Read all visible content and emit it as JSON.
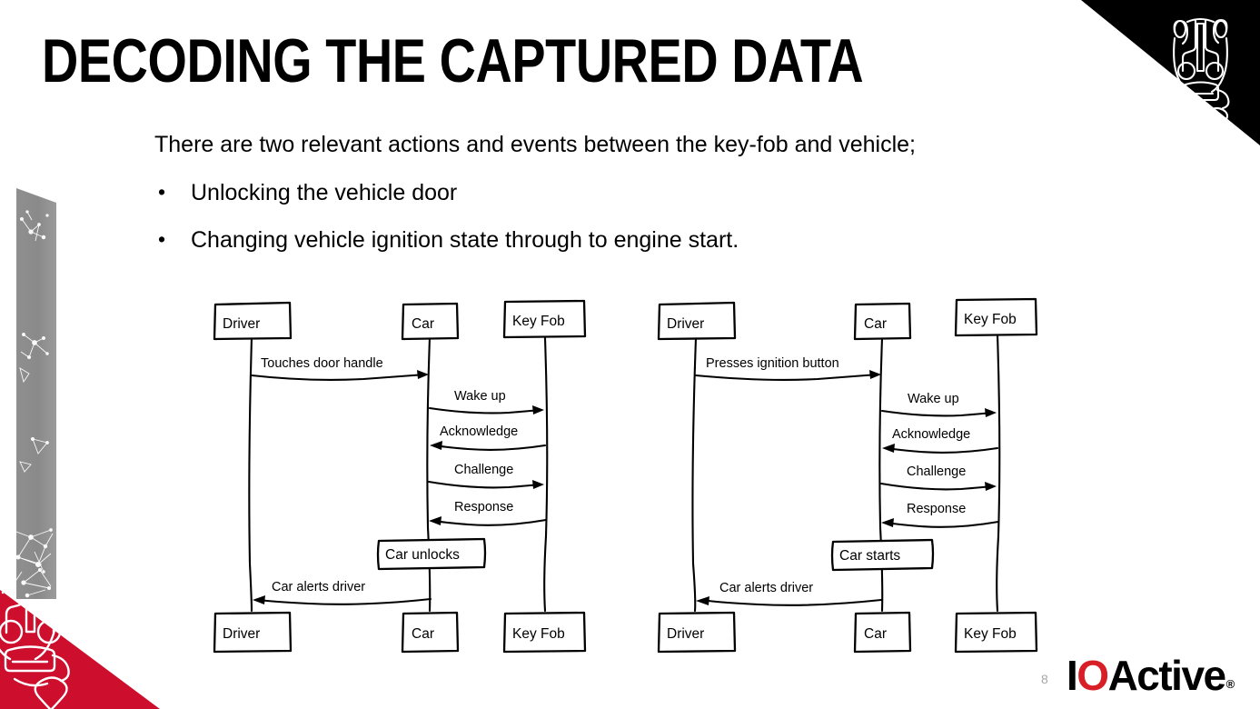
{
  "slide": {
    "title": "DECODING THE CAPTURED DATA",
    "page_number": "8",
    "accent_red": "#ce0e2d",
    "logo_red": "#d81f27",
    "band_gray": "#8c8c8c"
  },
  "body": {
    "lead": "There are two relevant actions and events between the key-fob and vehicle;",
    "bullet_marker": "•",
    "bullets": [
      "Unlocking the vehicle door",
      "Changing vehicle ignition state through to engine start."
    ]
  },
  "brand": {
    "logo_i": "I",
    "logo_o": "O",
    "logo_active": "Active",
    "logo_tm": "®",
    "corner_icon": "badger-head-icon",
    "bottom_icon": "badger-head-icon",
    "band_icon": "network-constellation-graphic"
  },
  "diagrams": [
    {
      "id": "unlock-sequence",
      "name": "Unlocking the vehicle door sequence",
      "actors": [
        "Driver",
        "Car",
        "Key Fob"
      ],
      "actors_bottom": [
        "Driver",
        "Car",
        "Key Fob"
      ],
      "messages": [
        {
          "label": "Touches door handle",
          "from": "Driver",
          "to": "Car",
          "direction": "right"
        },
        {
          "label": "Wake up",
          "from": "Car",
          "to": "Key Fob",
          "direction": "right"
        },
        {
          "label": "Acknowledge",
          "from": "Key Fob",
          "to": "Car",
          "direction": "left"
        },
        {
          "label": "Challenge",
          "from": "Car",
          "to": "Key Fob",
          "direction": "right"
        },
        {
          "label": "Response",
          "from": "Key Fob",
          "to": "Car",
          "direction": "left"
        },
        {
          "label": "Car alerts driver",
          "from": "Car",
          "to": "Driver",
          "direction": "left"
        }
      ],
      "activity": {
        "label": "Car unlocks",
        "on": "Car"
      }
    },
    {
      "id": "ignition-sequence",
      "name": "Changing ignition state to engine start sequence",
      "actors": [
        "Driver",
        "Car",
        "Key Fob"
      ],
      "actors_bottom": [
        "Driver",
        "Car",
        "Key Fob"
      ],
      "messages": [
        {
          "label": "Presses ignition button",
          "from": "Driver",
          "to": "Car",
          "direction": "right"
        },
        {
          "label": "Wake up",
          "from": "Car",
          "to": "Key Fob",
          "direction": "right"
        },
        {
          "label": "Acknowledge",
          "from": "Key Fob",
          "to": "Car",
          "direction": "left"
        },
        {
          "label": "Challenge",
          "from": "Car",
          "to": "Key Fob",
          "direction": "right"
        },
        {
          "label": "Response",
          "from": "Key Fob",
          "to": "Car",
          "direction": "left"
        },
        {
          "label": "Car alerts driver",
          "from": "Car",
          "to": "Driver",
          "direction": "left"
        }
      ],
      "activity": {
        "label": "Car starts",
        "on": "Car"
      }
    }
  ]
}
